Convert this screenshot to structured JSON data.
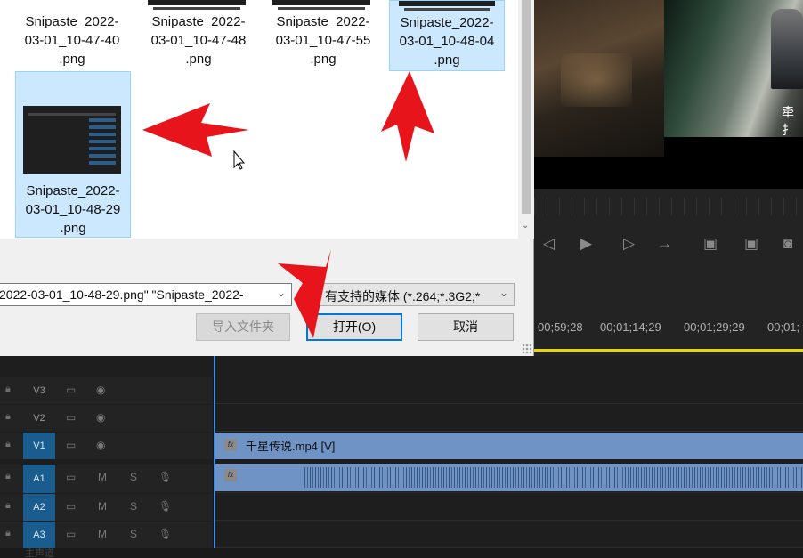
{
  "dialog": {
    "files": [
      {
        "name": "Snipaste_2022-\n03-01_10-47-40\n.png",
        "selected": false
      },
      {
        "name": "Snipaste_2022-\n03-01_10-47-48\n.png",
        "selected": false
      },
      {
        "name": "Snipaste_2022-\n03-01_10-47-55\n.png",
        "selected": false
      },
      {
        "name": "Snipaste_2022-\n03-01_10-48-04\n.png",
        "selected": true
      },
      {
        "name": "Snipaste_2022-\n03-01_10-48-29\n.png",
        "selected": true
      }
    ],
    "filename_value": "2022-03-01_10-48-29.png\" \"Snipaste_2022-",
    "filter_value": "有支持的媒体 (*.264;*.3G2;*",
    "import_folder_label": "导入文件夹",
    "open_label": "打开(O)",
    "cancel_label": "取消"
  },
  "monitor": {
    "subtitle": "牵扌"
  },
  "timeline": {
    "timecodes": [
      "00;59;28",
      "00;01;14;29",
      "00;01;29;29",
      "00;01;"
    ],
    "tracks": [
      {
        "name": "V3",
        "active": false
      },
      {
        "name": "V2",
        "active": false
      },
      {
        "name": "V1",
        "active": true
      },
      {
        "name": "A1",
        "active": true
      },
      {
        "name": "A2",
        "active": true
      },
      {
        "name": "A3",
        "active": true
      }
    ],
    "mute_label": "M",
    "solo_label": "S",
    "video_clip_label": "千星传说.mp4 [V]",
    "fx_label": "fx",
    "bottom_label": "主声道"
  },
  "colors": {
    "accent_blue": "#0078d7",
    "track_active": "#1b5c8e",
    "clip_blue": "#6f93c4",
    "playhead": "#3b8ee8",
    "annotation_red": "#e8141c"
  }
}
